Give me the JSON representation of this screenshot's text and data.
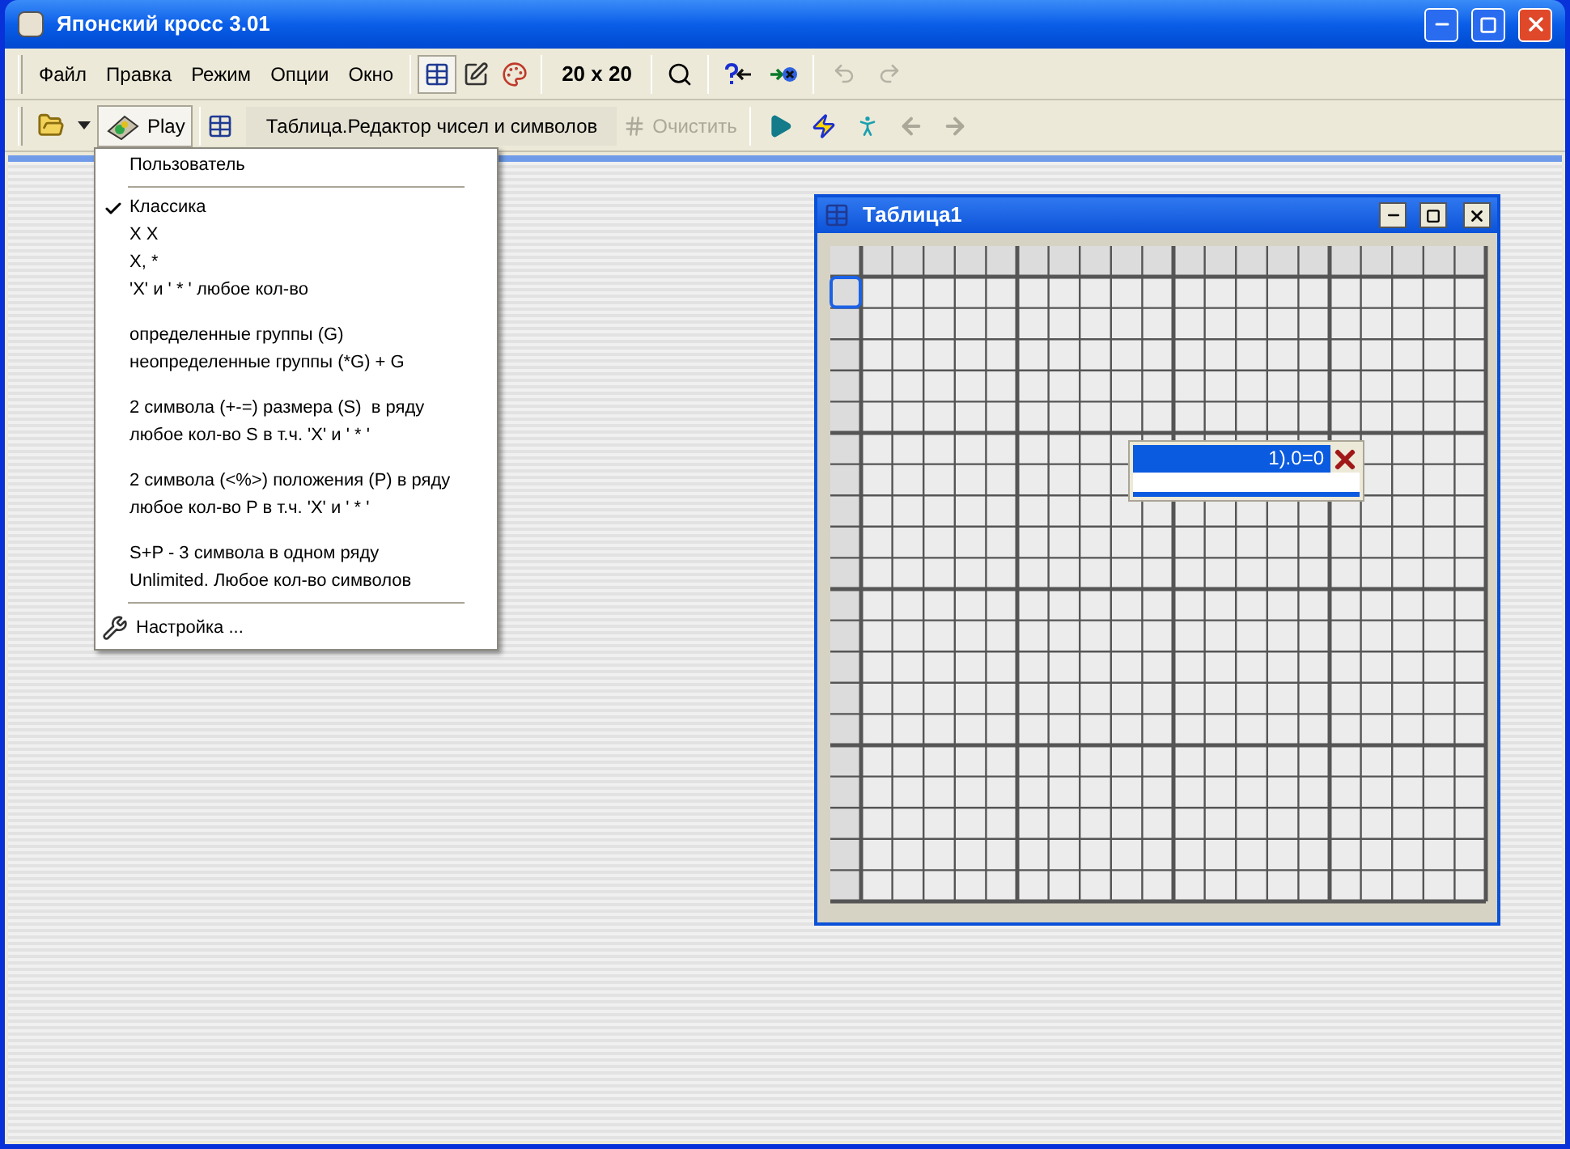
{
  "window": {
    "title": "Японский кросс 3.01"
  },
  "menu_bar": [
    "Файл",
    "Правка",
    "Режим",
    "Опции",
    "Окно"
  ],
  "view_tools": [
    {
      "pressed": true
    },
    {
      "pressed": false
    },
    {
      "pressed": false
    }
  ],
  "size_label": "20 x 20",
  "history_tools": [
    {
      "disabled": true
    },
    {
      "disabled": true
    }
  ],
  "toolbar2": {
    "play_label": "Play",
    "mode_label": "Таблица.Редактор чисел и символов",
    "clear": {
      "label": "Очистить",
      "disabled": true
    },
    "nav": [
      {
        "disabled": false
      },
      {
        "disabled": false
      },
      {
        "disabled": false
      },
      {
        "disabled": true
      },
      {
        "disabled": true
      }
    ]
  },
  "dropdown": [
    {
      "kind": "item",
      "label": "Пользователь",
      "checked": false
    },
    {
      "kind": "separator"
    },
    {
      "kind": "item",
      "label": "Классика",
      "checked": true
    },
    {
      "kind": "item",
      "label": "X X",
      "checked": false
    },
    {
      "kind": "item",
      "label": "X, *",
      "checked": false
    },
    {
      "kind": "item",
      "label": "'X' и ' * ' любое кол-во",
      "checked": false
    },
    {
      "kind": "gap"
    },
    {
      "kind": "item",
      "label": "определенные группы (G)",
      "checked": false
    },
    {
      "kind": "item",
      "label": "неопределенные группы (*G) + G",
      "checked": false
    },
    {
      "kind": "gap"
    },
    {
      "kind": "item",
      "label": "2 символа (+-=) размера (S)  в ряду",
      "checked": false
    },
    {
      "kind": "item",
      "label": "любое кол-во S в т.ч. 'X' и ' * '",
      "checked": false
    },
    {
      "kind": "gap"
    },
    {
      "kind": "item",
      "label": "2 символа (<%>) положения (P) в ряду",
      "checked": false
    },
    {
      "kind": "item",
      "label": "любое кол-во P в т.ч. 'X' и ' * '",
      "checked": false
    },
    {
      "kind": "gap"
    },
    {
      "kind": "item",
      "label": "S+P - 3 символа в одном ряду",
      "checked": false
    },
    {
      "kind": "item",
      "label": "Unlimited. Любое кол-во символов",
      "checked": false
    },
    {
      "kind": "separator"
    },
    {
      "kind": "settings",
      "label": "Настройка ..."
    }
  ],
  "child_window": {
    "title": "Таблица1",
    "popup_value": "1).0=0"
  }
}
